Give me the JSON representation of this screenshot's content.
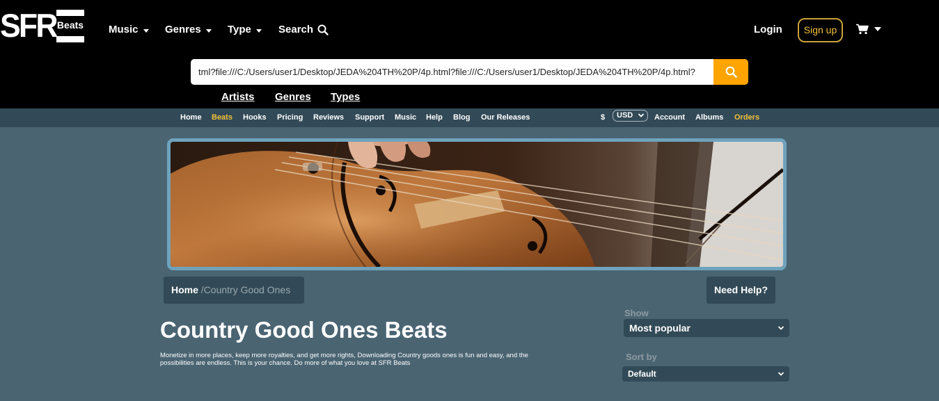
{
  "logo": {
    "wordmark": "SFR",
    "sub": "Beats"
  },
  "header": {
    "nav": [
      {
        "label": "Music"
      },
      {
        "label": "Genres"
      },
      {
        "label": "Type"
      },
      {
        "label": "Search"
      }
    ],
    "login": "Login",
    "signup": "Sign up",
    "cart_icon": "cart-icon"
  },
  "search": {
    "value": "tml?file:///C:/Users/user1/Desktop/JEDA%204TH%20P/4p.html?file:///C:/Users/user1/Desktop/JEDA%204TH%20P/4p.html?",
    "button_icon": "search-icon",
    "button_color": "#ffa400"
  },
  "quicklinks": [
    "Artists",
    "Genres",
    "Types"
  ],
  "subnav": {
    "items": [
      "Home",
      "Beats",
      "Hooks",
      "Pricing",
      "Reviews",
      "Support",
      "Music",
      "Help",
      "Blog",
      "Our Releases"
    ],
    "active": "Beats",
    "currency_symbol": "$",
    "currency": "USD",
    "right_items": [
      "Account",
      "Albums",
      "Orders"
    ],
    "accent_color": "#f3c13a"
  },
  "breadcrumb": {
    "home": "Home",
    "separator": "/",
    "current": "Country Good Ones"
  },
  "need_help": "Need Help?",
  "page": {
    "title": "Country Good Ones Beats",
    "description": "Monetize in more places, keep more royalties, and get more rights, Downloading Country goods ones is fun and easy, and the possibilities are endless. This is your chance. Do more of what you love at SFR Beats"
  },
  "filters": {
    "show_label": "Show",
    "show_value": "Most popular",
    "sort_label": "Sort by",
    "sort_value": "Default"
  },
  "colors": {
    "header_bg": "#000000",
    "subnav_bg": "#324a57",
    "page_bg": "#4a6472",
    "banner_border": "#6fa3bd",
    "signup_border": "#c9a23a"
  }
}
